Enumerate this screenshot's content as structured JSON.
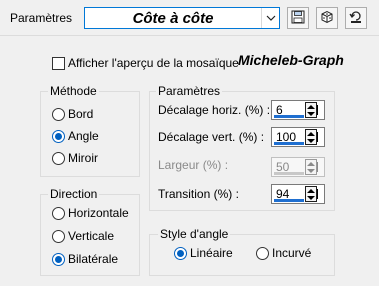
{
  "header": {
    "presets_label": "Paramètres",
    "preset_value": "Côte à côte",
    "icons": [
      "save-icon",
      "dice-icon",
      "reset-icon"
    ]
  },
  "options": {
    "show_preview_label": "Afficher l'aperçu de la mosaïque",
    "show_preview_checked": false,
    "brand": "Micheleb-Graph"
  },
  "method": {
    "title": "Méthode",
    "items": [
      "Bord",
      "Angle",
      "Miroir"
    ],
    "selected": "Angle"
  },
  "direction": {
    "title": "Direction",
    "items": [
      "Horizontale",
      "Verticale",
      "Bilatérale"
    ],
    "selected": "Bilatérale"
  },
  "params": {
    "title": "Paramètres",
    "offset_h_label": "Décalage horiz. (%) :",
    "offset_h_value": "6",
    "offset_v_label": "Décalage vert. (%) :",
    "offset_v_value": "100",
    "width_label": "Largeur (%) :",
    "width_value": "50",
    "transition_label": "Transition (%) :",
    "transition_value": "94"
  },
  "corner_style": {
    "title": "Style d'angle",
    "items": [
      "Linéaire",
      "Incurvé"
    ],
    "selected": "Linéaire"
  },
  "colors": {
    "accent": "#0060c0",
    "focus_border": "#0078d7",
    "background": "#f0f0f0"
  }
}
